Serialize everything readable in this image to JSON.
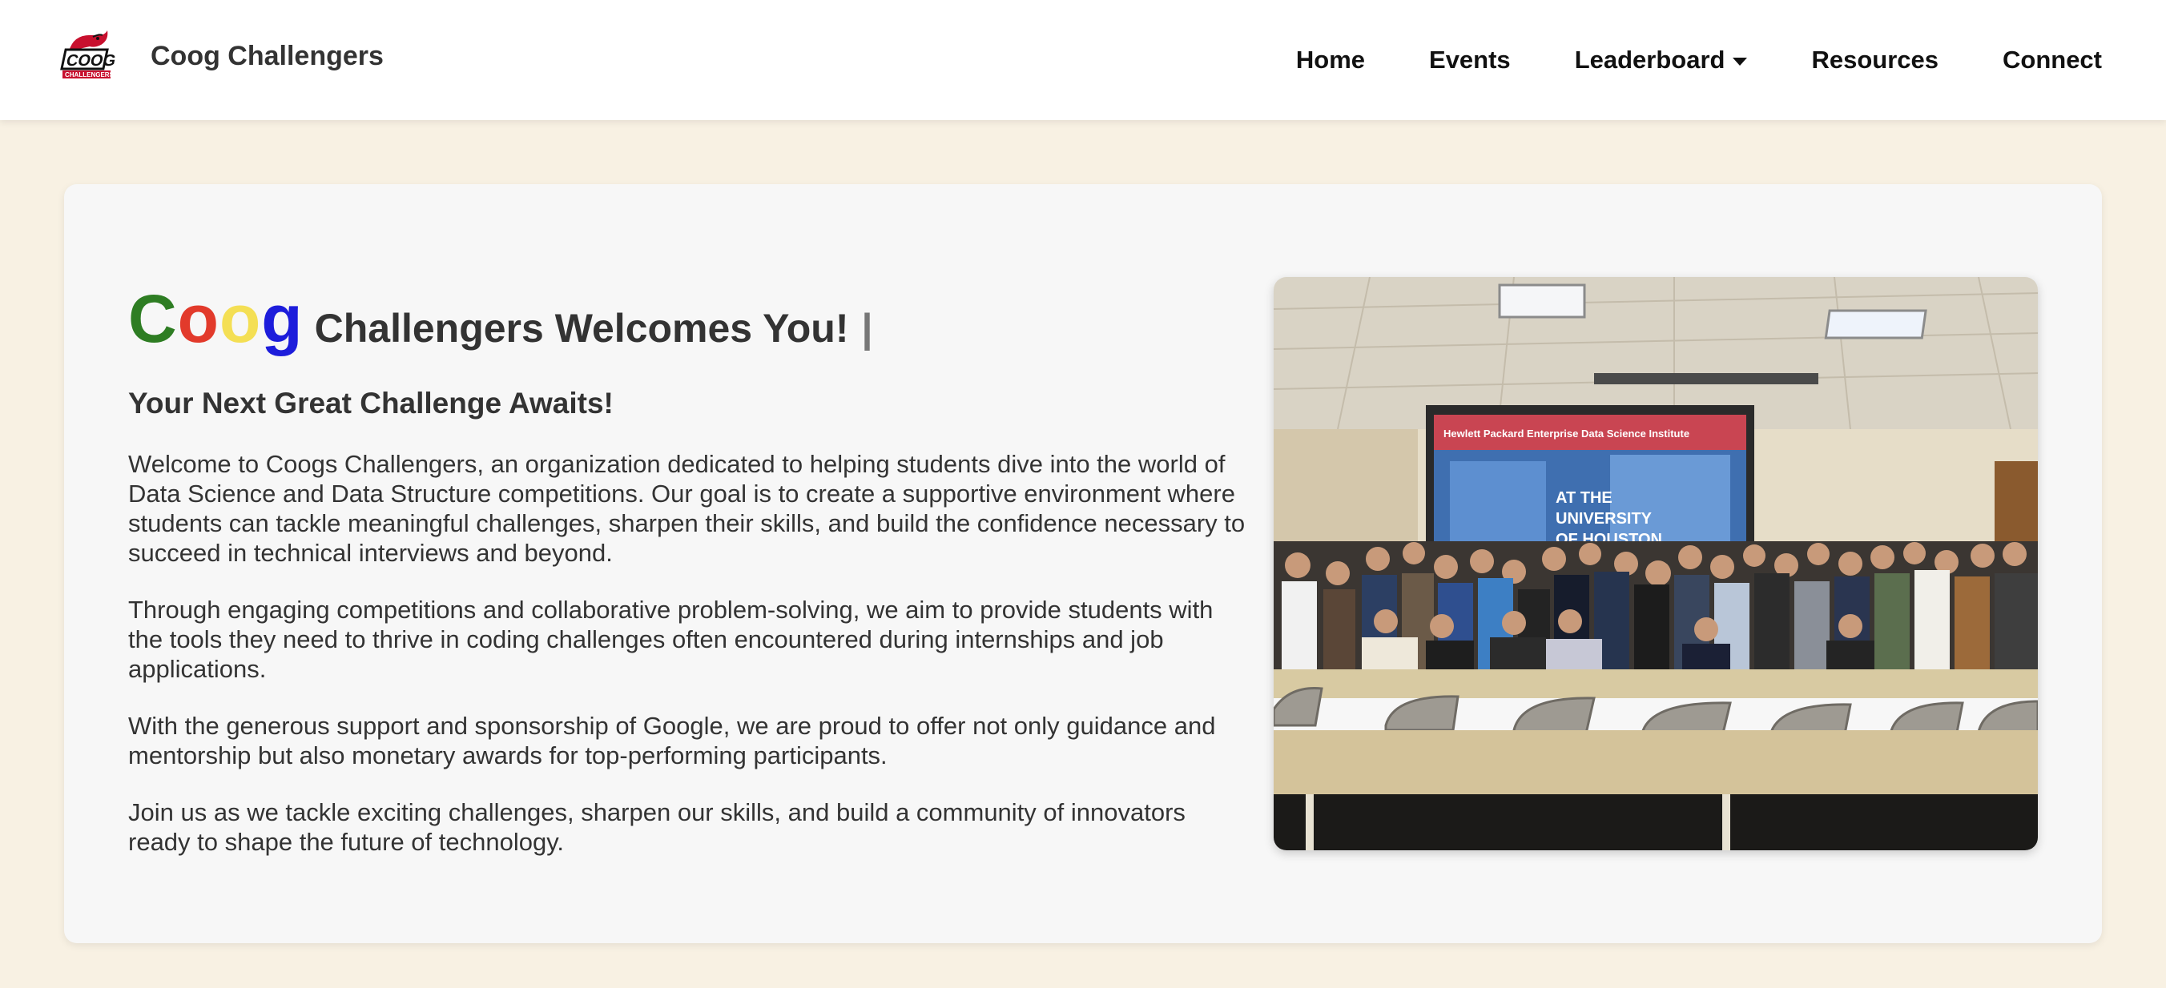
{
  "header": {
    "brand_name": "Coog Challengers",
    "logo_icon": "coog-challengers-logo",
    "nav": [
      {
        "label": "Home"
      },
      {
        "label": "Events"
      },
      {
        "label": "Leaderboard",
        "has_dropdown": true
      },
      {
        "label": "Resources"
      },
      {
        "label": "Connect"
      }
    ]
  },
  "hero": {
    "coog_letters": [
      {
        "char": "C",
        "color": "#2e7d23"
      },
      {
        "char": "o",
        "color": "#e23a2b"
      },
      {
        "char": "o",
        "color": "#f4df54"
      },
      {
        "char": "g",
        "color": "#1d1ddb"
      }
    ],
    "title_rest": "Challengers Welcomes You!",
    "cursor": "|",
    "tagline": "Your Next Great Challenge Awaits!",
    "paragraphs": [
      "Welcome to Coogs Challengers, an organization dedicated to helping students dive into the world of Data Science and Data Structure competitions. Our goal is to create a supportive environment where students can tackle meaningful challenges, sharpen their skills, and build the confidence necessary to succeed in technical interviews and beyond.",
      "Through engaging competitions and collaborative problem-solving, we aim to provide students with the tools they need to thrive in coding challenges often encountered during internships and job applications.",
      "With the generous support and sponsorship of Google, we are proud to offer not only guidance and mentorship but also monetary awards for top-performing participants.",
      "Join us as we tackle exciting challenges, sharpen our skills, and build a community of innovators ready to shape the future of technology."
    ],
    "photo_screen_text": [
      "Hewlett Packard Enterprise Data Science Institute",
      "AT THE",
      "UNIVERSITY",
      "OF HOUSTON"
    ]
  },
  "colors": {
    "page_background": "#f8f1e3",
    "card_background": "#f7f7f7",
    "text": "#333333"
  }
}
